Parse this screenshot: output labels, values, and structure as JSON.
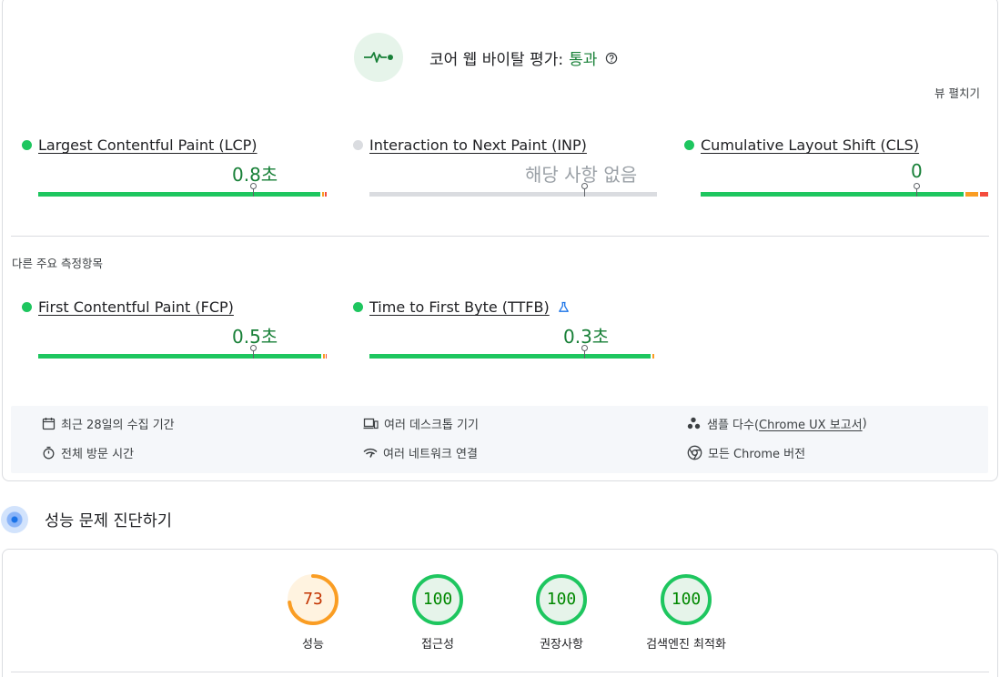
{
  "cwv": {
    "title": "코어 웹 바이탈 평가:",
    "status": "통과",
    "expand_label": "뷰 펼치기"
  },
  "core_metrics": [
    {
      "name": "Largest Contentful Paint (LCP)",
      "value": "0.8초",
      "status_color": "#1ec65f"
    },
    {
      "name": "Interaction to Next Paint (INP)",
      "value": "해당 사항 없음",
      "status_color": "#dadce0"
    },
    {
      "name": "Cumulative Layout Shift (CLS)",
      "value": "0",
      "status_color": "#1ec65f"
    }
  ],
  "other_section_label": "다른 주요 측정항목",
  "other_metrics": [
    {
      "name": "First Contentful Paint (FCP)",
      "value": "0.5초",
      "status_color": "#1ec65f"
    },
    {
      "name": "Time to First Byte (TTFB)",
      "value": "0.3초",
      "status_color": "#1ec65f",
      "badge_icon": "flask-icon"
    }
  ],
  "info": {
    "period": "최근 28일의 수집 기간",
    "devices": "여러 데스크톱 기기",
    "samples_prefix": "샘플 다수(",
    "samples_link": "Chrome UX 보고서",
    "samples_suffix": ")",
    "visit": "전체 방문 시간",
    "network": "여러 네트워크 연결",
    "chrome": "모든 Chrome 버전"
  },
  "diagnose": {
    "title": "성능 문제 진단하기"
  },
  "scores": [
    {
      "label": "성능",
      "score": 73,
      "color": "#fa9d23",
      "text_color": "#c33300",
      "bg": "#fff3e0"
    },
    {
      "label": "접근성",
      "score": 100,
      "color": "#1ec65f",
      "text_color": "#008800",
      "bg": "#e6f4ea"
    },
    {
      "label": "권장사항",
      "score": 100,
      "color": "#1ec65f",
      "text_color": "#008800",
      "bg": "#e6f4ea"
    },
    {
      "label": "검색엔진 최적화",
      "score": 100,
      "color": "#1ec65f",
      "text_color": "#008800",
      "bg": "#e6f4ea"
    }
  ],
  "colors": {
    "good": "#1ec65f",
    "needs_improvement": "#fa9d23",
    "poor": "#f44c3d",
    "neutral": "#dadce0"
  }
}
